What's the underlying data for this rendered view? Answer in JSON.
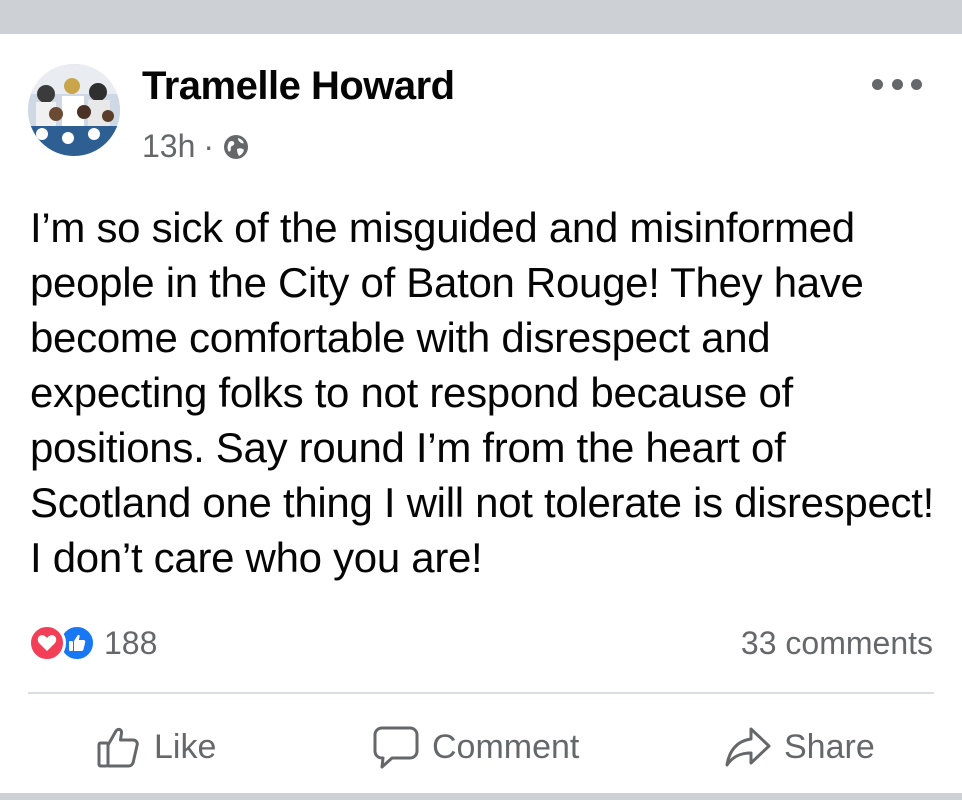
{
  "post": {
    "author": "Tramelle Howard",
    "time": "13h",
    "separator": "·",
    "privacy_icon": "globe-icon",
    "body": "I’m so sick of the misguided and misinformed people in the City of Baton Rouge! They have become comfortable with disrespect and expecting folks to not respond because of positions. Say round I’m from the heart of Scotland one thing I will not tolerate is disrespect! I don’t care who you are!",
    "reactions": {
      "types": [
        "love",
        "like"
      ],
      "count": "188"
    },
    "comments_label": "33 comments"
  },
  "actions": {
    "like": "Like",
    "comment": "Comment",
    "share": "Share"
  },
  "colors": {
    "text": "#050505",
    "secondary": "#65676b",
    "like_blue": "#1877f2",
    "love_red": "#f33e58",
    "divider": "#dadde1",
    "frame": "#cdd0d4"
  }
}
